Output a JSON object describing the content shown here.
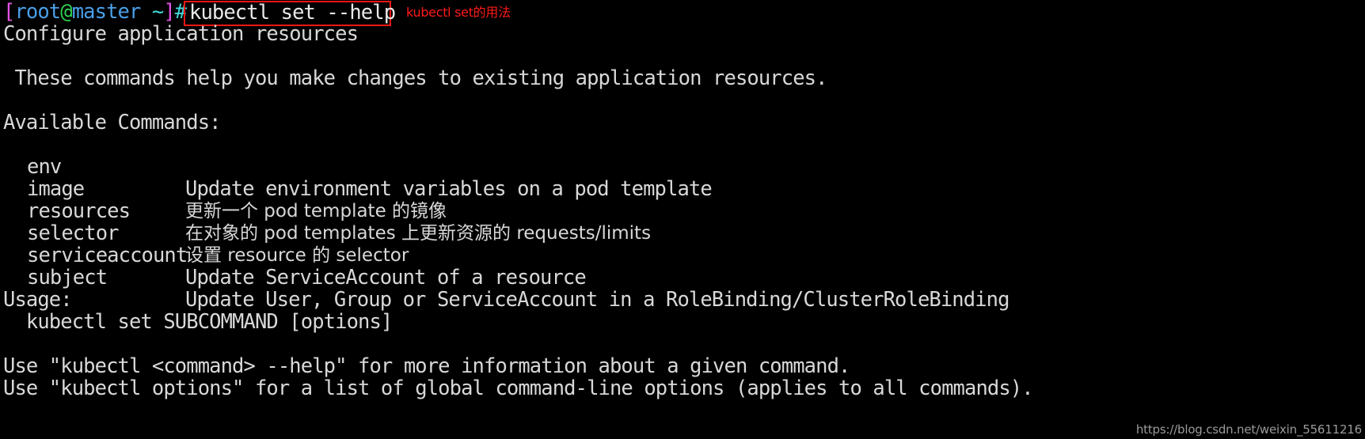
{
  "terminal": {
    "background_color": "#000000",
    "foreground_color": "#d8d8d8",
    "prompt": {
      "open_bracket": "[",
      "user": "root",
      "at": "@",
      "host": "master",
      "space_tilde": " ~",
      "close_bracket": "]",
      "hash": "#",
      "colors": {
        "bracket": "#e453e4",
        "user": "#4a9fe8",
        "at": "#2fd14f",
        "host": "#4a9fe8",
        "tilde": "#3fd8d8",
        "hash": "#3fd8d8"
      }
    },
    "command": "kubectl set --help",
    "annotation": {
      "text": "kubectl set的用法",
      "color": "#ff1a1a"
    },
    "highlight_box_color": "#f21616",
    "output": {
      "title": "Configure application resources",
      "intro": " These commands help you make changes to existing application resources.",
      "available_commands_header": "Available Commands:",
      "commands": [
        {
          "name": "env",
          "description": "Update environment variables on a pod template"
        },
        {
          "name": "image",
          "description": "更新一个 pod template 的镜像"
        },
        {
          "name": "resources",
          "description": "在对象的 pod templates 上更新资源的 requests/limits"
        },
        {
          "name": "selector",
          "description": "设置 resource 的 selector"
        },
        {
          "name": "serviceaccount",
          "description": "Update ServiceAccount of a resource"
        },
        {
          "name": "subject",
          "description": "Update User, Group or ServiceAccount in a RoleBinding/ClusterRoleBinding"
        }
      ],
      "usage_header": "Usage:",
      "usage_line": "  kubectl set SUBCOMMAND [options]",
      "footer_line_1": "Use \"kubectl <command> --help\" for more information about a given command.",
      "footer_line_2": "Use \"kubectl options\" for a list of global command-line options (applies to all commands)."
    }
  },
  "watermark": "https://blog.csdn.net/weixin_55611216"
}
